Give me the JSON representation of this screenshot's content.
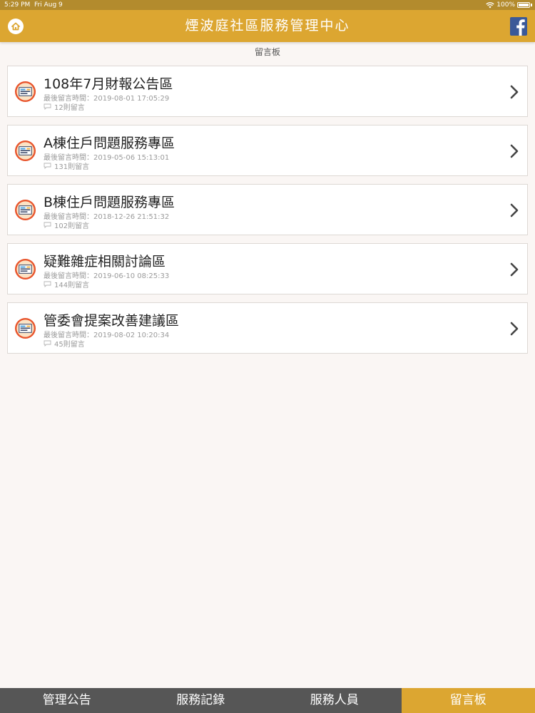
{
  "status_bar": {
    "time": "5:29 PM",
    "date": "Fri Aug 9",
    "battery": "100%"
  },
  "header": {
    "title": "煙波庭社區服務管理中心",
    "home_icon": "home-icon",
    "facebook_icon": "facebook-icon"
  },
  "page": {
    "title": "留言板"
  },
  "boards": [
    {
      "name": "108年7月財報公告區",
      "last_time": "最後留言時間：2019-08-01 17:05:29",
      "count": "12則留言"
    },
    {
      "name": "A棟住戶問題服務專區",
      "last_time": "最後留言時間：2019-05-06 15:13:01",
      "count": "131則留言"
    },
    {
      "name": "B棟住戶問題服務專區",
      "last_time": "最後留言時間：2018-12-26 21:51:32",
      "count": "102則留言"
    },
    {
      "name": "疑難雜症相關討論區",
      "last_time": "最後留言時間：2019-06-10 08:25:33",
      "count": "144則留言"
    },
    {
      "name": "管委會提案改善建議區",
      "last_time": "最後留言時間：2019-08-02 10:20:34",
      "count": "45則留言"
    }
  ],
  "tabs": [
    {
      "label": "管理公告"
    },
    {
      "label": "服務記錄"
    },
    {
      "label": "服務人員"
    },
    {
      "label": "留言板"
    }
  ],
  "colors": {
    "accent": "#dca631",
    "status_bar": "#b38b2d",
    "tab_bar": "#565656"
  }
}
